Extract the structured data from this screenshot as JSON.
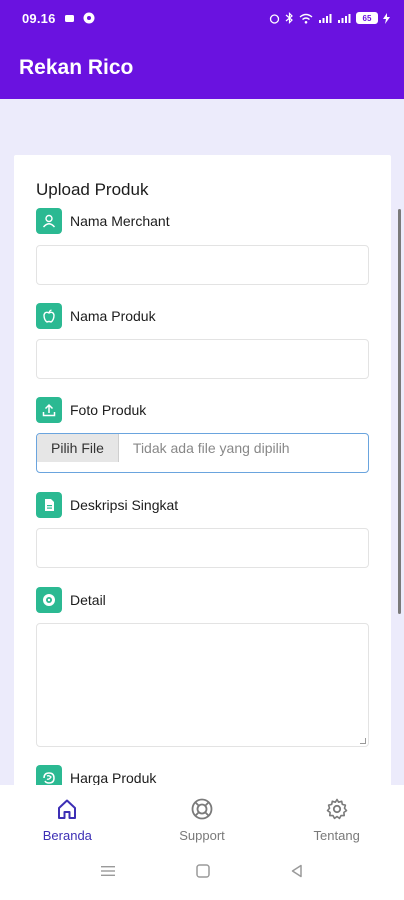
{
  "status_bar": {
    "time": "09.16",
    "battery": "65"
  },
  "app": {
    "title": "Rekan Rico"
  },
  "form": {
    "title": "Upload Produk",
    "fields": {
      "merchant": {
        "label": "Nama Merchant",
        "value": ""
      },
      "product": {
        "label": "Nama Produk",
        "value": ""
      },
      "photo": {
        "label": "Foto Produk",
        "button": "Pilih File",
        "status": "Tidak ada file yang dipilih"
      },
      "short_desc": {
        "label": "Deskripsi Singkat",
        "value": ""
      },
      "detail": {
        "label": "Detail",
        "value": ""
      },
      "price": {
        "label": "Harga Produk"
      }
    }
  },
  "nav": {
    "items": [
      {
        "label": "Beranda",
        "icon": "home-icon",
        "active": true
      },
      {
        "label": "Support",
        "icon": "lifebuoy-icon",
        "active": false
      },
      {
        "label": "Tentang",
        "icon": "gear-icon",
        "active": false
      }
    ]
  },
  "colors": {
    "primary": "#6a12e0",
    "accent": "#2bb992",
    "nav_active": "#3d2fb5"
  }
}
